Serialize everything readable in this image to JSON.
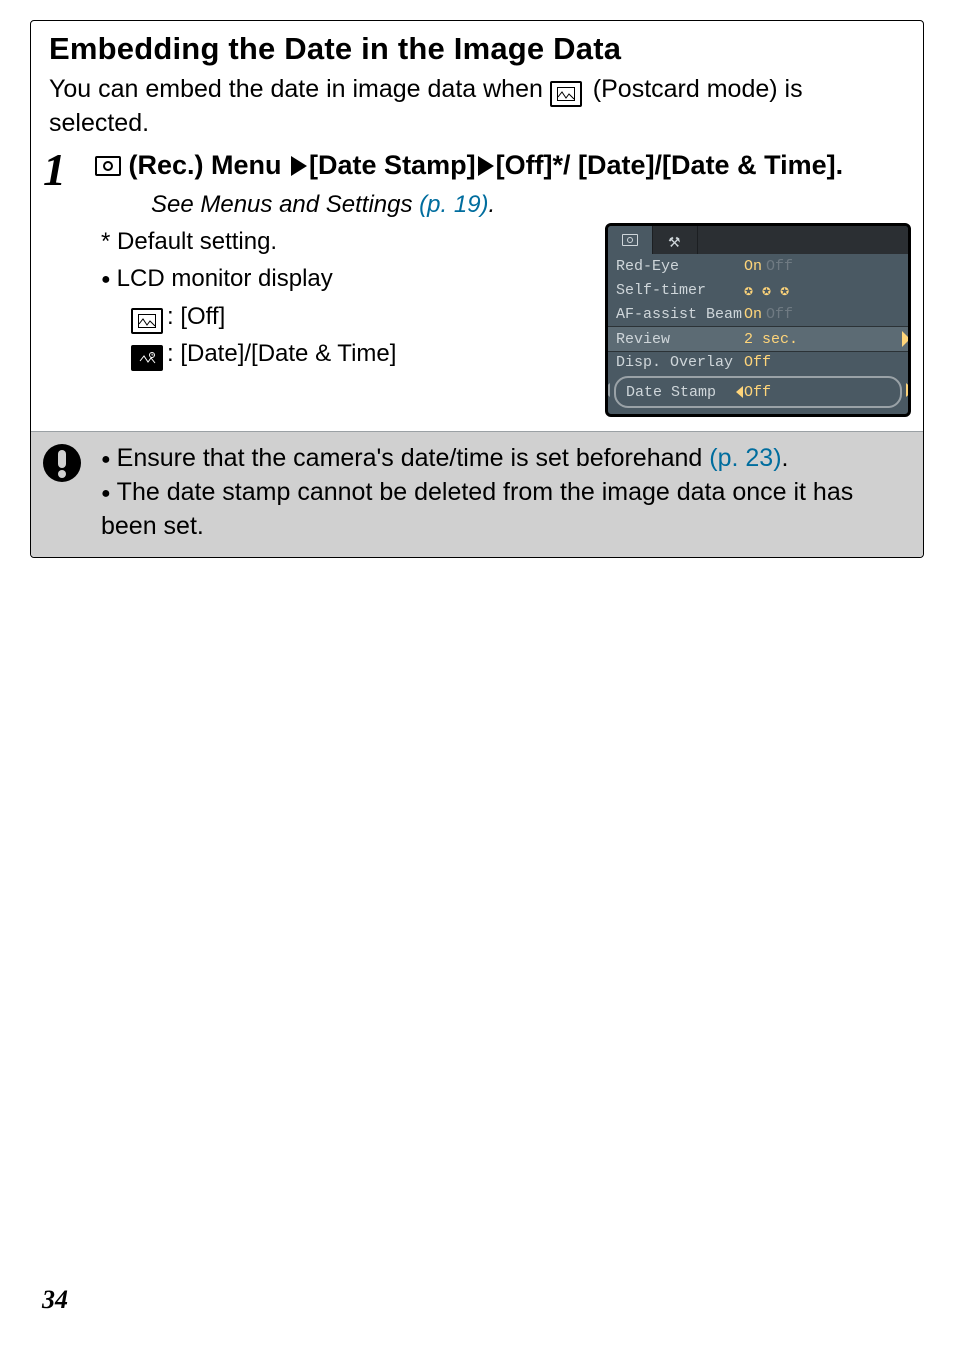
{
  "title": "Embedding the Date in the Image Data",
  "intro_1": "You can embed the date in image data when ",
  "intro_2": " (Postcard mode) is selected.",
  "step_num": "1",
  "step_menu": "(Rec.) Menu",
  "step_path_1": "[Date Stamp]",
  "step_path_2": "[Off]*/ [Date]/[Date & Time].",
  "see_prefix": "See Menus and Settings ",
  "see_link": "(p. 19)",
  "see_suffix": ".",
  "default_line": "* Default setting.",
  "lcd_line": "LCD monitor display",
  "disp1": ": [Off]",
  "disp2": ": [Date]/[Date & Time]",
  "menu": {
    "r1_l": "Red-Eye",
    "r1_on": "On",
    "r1_off": "Off",
    "r2_l": "Self-timer",
    "r3_l": "AF-assist Beam",
    "r3_on": "On",
    "r3_off": "Off",
    "r4_l": "Review",
    "r4_v": "2 sec.",
    "r5_l": "Disp. Overlay",
    "r5_v": "Off",
    "r6_l": "Date Stamp",
    "r6_v": "Off"
  },
  "notice1a": "Ensure that the camera's date/time is set beforehand ",
  "notice1_link": "(p. 23)",
  "notice1b": ".",
  "notice2": "The date stamp cannot be deleted from the image data once it has been set.",
  "page_number": "34"
}
